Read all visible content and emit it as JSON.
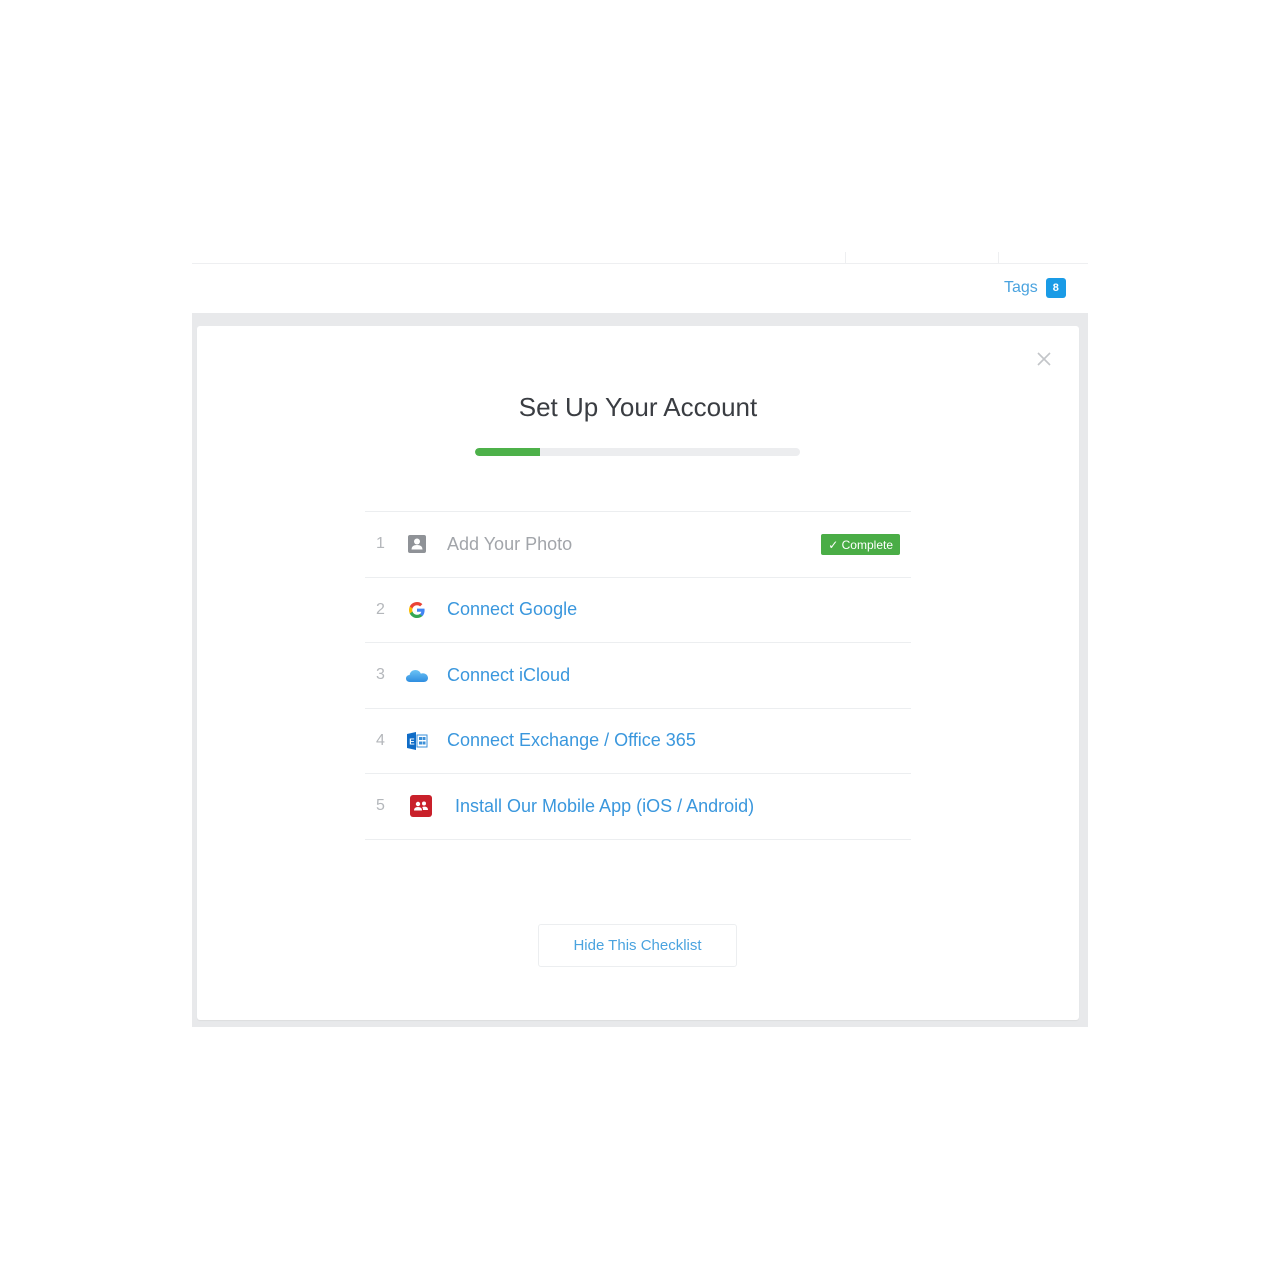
{
  "header": {
    "tags_label": "Tags",
    "tags_count": "8"
  },
  "checklist_panel": {
    "title": "Set Up Your Account",
    "progress_fraction": 0.2,
    "close_icon": "close-icon",
    "items": [
      {
        "number": "1",
        "icon": "user-photo-icon",
        "label": "Add Your Photo",
        "status": "complete",
        "badge": "✓ Complete"
      },
      {
        "number": "2",
        "icon": "google-icon",
        "label": "Connect Google",
        "status": "incomplete"
      },
      {
        "number": "3",
        "icon": "icloud-icon",
        "label": "Connect iCloud",
        "status": "incomplete"
      },
      {
        "number": "4",
        "icon": "exchange-icon",
        "label": "Connect Exchange / Office 365",
        "status": "incomplete"
      },
      {
        "number": "5",
        "icon": "mobile-app-icon",
        "label": "Install Our Mobile App (iOS / Android)",
        "status": "incomplete"
      }
    ],
    "hide_button_label": "Hide This Checklist"
  },
  "colors": {
    "accent_blue": "#3a97dd",
    "progress_green": "#4db14a",
    "badge_blue": "#1a9be6",
    "complete_green": "#4aad46"
  }
}
